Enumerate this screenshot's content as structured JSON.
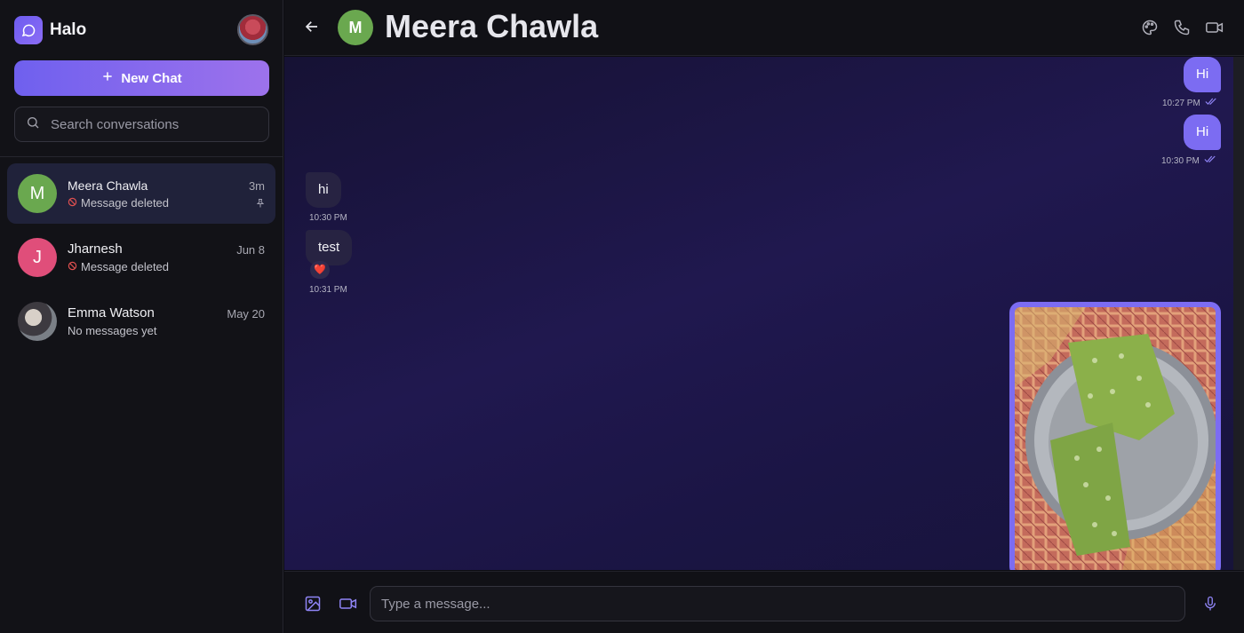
{
  "sidebar": {
    "app_name": "Halo",
    "new_chat_label": "New Chat",
    "search_placeholder": "Search conversations",
    "conversations": [
      {
        "initial": "M",
        "name": "Meera Chawla",
        "preview": "Message deleted",
        "time": "3m",
        "avatar_color": "#6aa84f",
        "active": true,
        "pinned": true
      },
      {
        "initial": "J",
        "name": "Jharnesh",
        "preview": "Message deleted",
        "time": "Jun 8",
        "avatar_color": "#e04e7a",
        "active": false,
        "pinned": false
      },
      {
        "initial": "",
        "name": "Emma Watson",
        "preview": "No messages yet",
        "time": "May 20",
        "avatar_color": "#8a8f96",
        "active": false,
        "pinned": false
      }
    ]
  },
  "chat": {
    "contact_initial": "M",
    "contact_name": "Meera Chawla",
    "messages": [
      {
        "direction": "out",
        "text": "Hi",
        "time": "10:27 PM",
        "read": true
      },
      {
        "direction": "out",
        "text": "Hi",
        "time": "10:30 PM",
        "read": true
      },
      {
        "direction": "in",
        "text": "hi",
        "time": "10:30 PM"
      },
      {
        "direction": "in",
        "text": "test",
        "time": "10:31 PM",
        "reaction": "❤️"
      },
      {
        "direction": "out",
        "type": "image"
      }
    ],
    "composer_placeholder": "Type a message..."
  },
  "icons": [
    "chat-bubble-icon",
    "plus-icon",
    "search-icon",
    "deleted-icon",
    "pin-icon",
    "back-arrow-icon",
    "palette-icon",
    "phone-icon",
    "video-icon",
    "image-icon",
    "mic-icon",
    "double-check-icon"
  ],
  "colors": {
    "accent": "#7c6cf2",
    "background": "#121217",
    "chat_background": "#1b1545"
  }
}
